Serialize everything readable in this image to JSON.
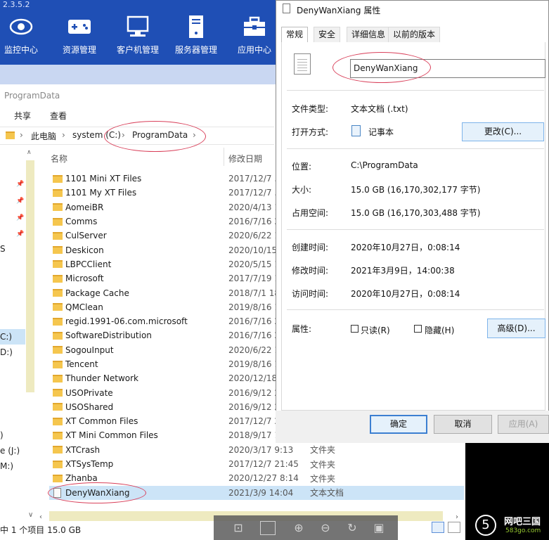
{
  "app": {
    "version": "2.3.5.2",
    "toolbar": [
      {
        "label": "监控中心",
        "icon": "monitor-eye-icon"
      },
      {
        "label": "资源管理",
        "icon": "gamepad-icon"
      },
      {
        "label": "客户机管理",
        "icon": "computer-icon"
      },
      {
        "label": "服务器管理",
        "icon": "server-icon"
      },
      {
        "label": "应用中心",
        "icon": "toolbox-icon"
      }
    ]
  },
  "explorer": {
    "window_title": "ProgramData",
    "ribbon_tabs": [
      "共享",
      "查看"
    ],
    "breadcrumb": [
      "此电脑",
      "system (C:)",
      "ProgramData"
    ],
    "columns": {
      "name": "名称",
      "date": "修改日期"
    },
    "nav_labels": [
      "S",
      "C:)",
      "D:)",
      ")",
      "e (J:)",
      "M:)"
    ],
    "files": [
      {
        "name": "1101 Mini XT Files",
        "date": "2017/12/7 ...",
        "type": ""
      },
      {
        "name": "1101 My XT Files",
        "date": "2017/12/7 ...",
        "type": ""
      },
      {
        "name": "AomeiBR",
        "date": "2020/4/13 1...",
        "type": ""
      },
      {
        "name": "Comms",
        "date": "2016/7/16 2...",
        "type": ""
      },
      {
        "name": "CulServer",
        "date": "2020/6/22 1...",
        "type": ""
      },
      {
        "name": "Deskicon",
        "date": "2020/10/15 ...",
        "type": ""
      },
      {
        "name": "LBPCClient",
        "date": "2020/5/15 1...",
        "type": ""
      },
      {
        "name": "Microsoft",
        "date": "2017/7/19 1...",
        "type": ""
      },
      {
        "name": "Package Cache",
        "date": "2018/7/1 18...",
        "type": ""
      },
      {
        "name": "QMClean",
        "date": "2019/8/16 1...",
        "type": ""
      },
      {
        "name": "regid.1991-06.com.microsoft",
        "date": "2016/7/16 2...",
        "type": ""
      },
      {
        "name": "SoftwareDistribution",
        "date": "2016/7/16 2...",
        "type": ""
      },
      {
        "name": "SogouInput",
        "date": "2020/6/22 1...",
        "type": ""
      },
      {
        "name": "Tencent",
        "date": "2019/8/16 1...",
        "type": ""
      },
      {
        "name": "Thunder Network",
        "date": "2020/12/18 ...",
        "type": ""
      },
      {
        "name": "USOPrivate",
        "date": "2016/9/12 2...",
        "type": ""
      },
      {
        "name": "USOShared",
        "date": "2016/9/12 2...",
        "type": ""
      },
      {
        "name": "XT Common Files",
        "date": "2017/12/7 2...",
        "type": ""
      },
      {
        "name": "XT Mini Common Files",
        "date": "2018/9/17 1...",
        "type": ""
      },
      {
        "name": "XTCrash",
        "date": "2020/3/17 9:13",
        "type": "文件夹"
      },
      {
        "name": "XTSysTemp",
        "date": "2017/12/7 21:45",
        "type": "文件夹"
      },
      {
        "name": "Zhanba",
        "date": "2020/12/27 8:14",
        "type": "文件夹"
      },
      {
        "name": "DenyWanXiang",
        "date": "2021/3/9 14:04",
        "type": "文本文档"
      }
    ],
    "status": "中 1 个项目  15.0 GB"
  },
  "watermark": {
    "brand": "网吧三国",
    "site": "583go.com",
    "logo_char": "5"
  },
  "dialog": {
    "title": "DenyWanXiang 属性",
    "tabs": [
      "常规",
      "安全",
      "详细信息",
      "以前的版本"
    ],
    "active_tab": "常规",
    "filename": "DenyWanXiang",
    "file_type_label": "文件类型:",
    "file_type": "文本文档 (.txt)",
    "open_with_label": "打开方式:",
    "open_with": "记事本",
    "change_button": "更改(C)...",
    "location_label": "位置:",
    "location": "C:\\ProgramData",
    "size_label": "大小:",
    "size": "15.0 GB (16,170,302,177 字节)",
    "size_on_disk_label": "占用空间:",
    "size_on_disk": "15.0 GB (16,170,303,488 字节)",
    "created_label": "创建时间:",
    "created": "2020年10月27日，0:08:14",
    "modified_label": "修改时间:",
    "modified": "2021年3月9日，14:00:38",
    "accessed_label": "访问时间:",
    "accessed": "2020年10月27日，0:08:14",
    "attributes_label": "属性:",
    "readonly_label": "只读(R)",
    "hidden_label": "隐藏(H)",
    "advanced_button": "高级(D)...",
    "ok_button": "确定",
    "cancel_button": "取消",
    "apply_button": "应用(A)"
  }
}
